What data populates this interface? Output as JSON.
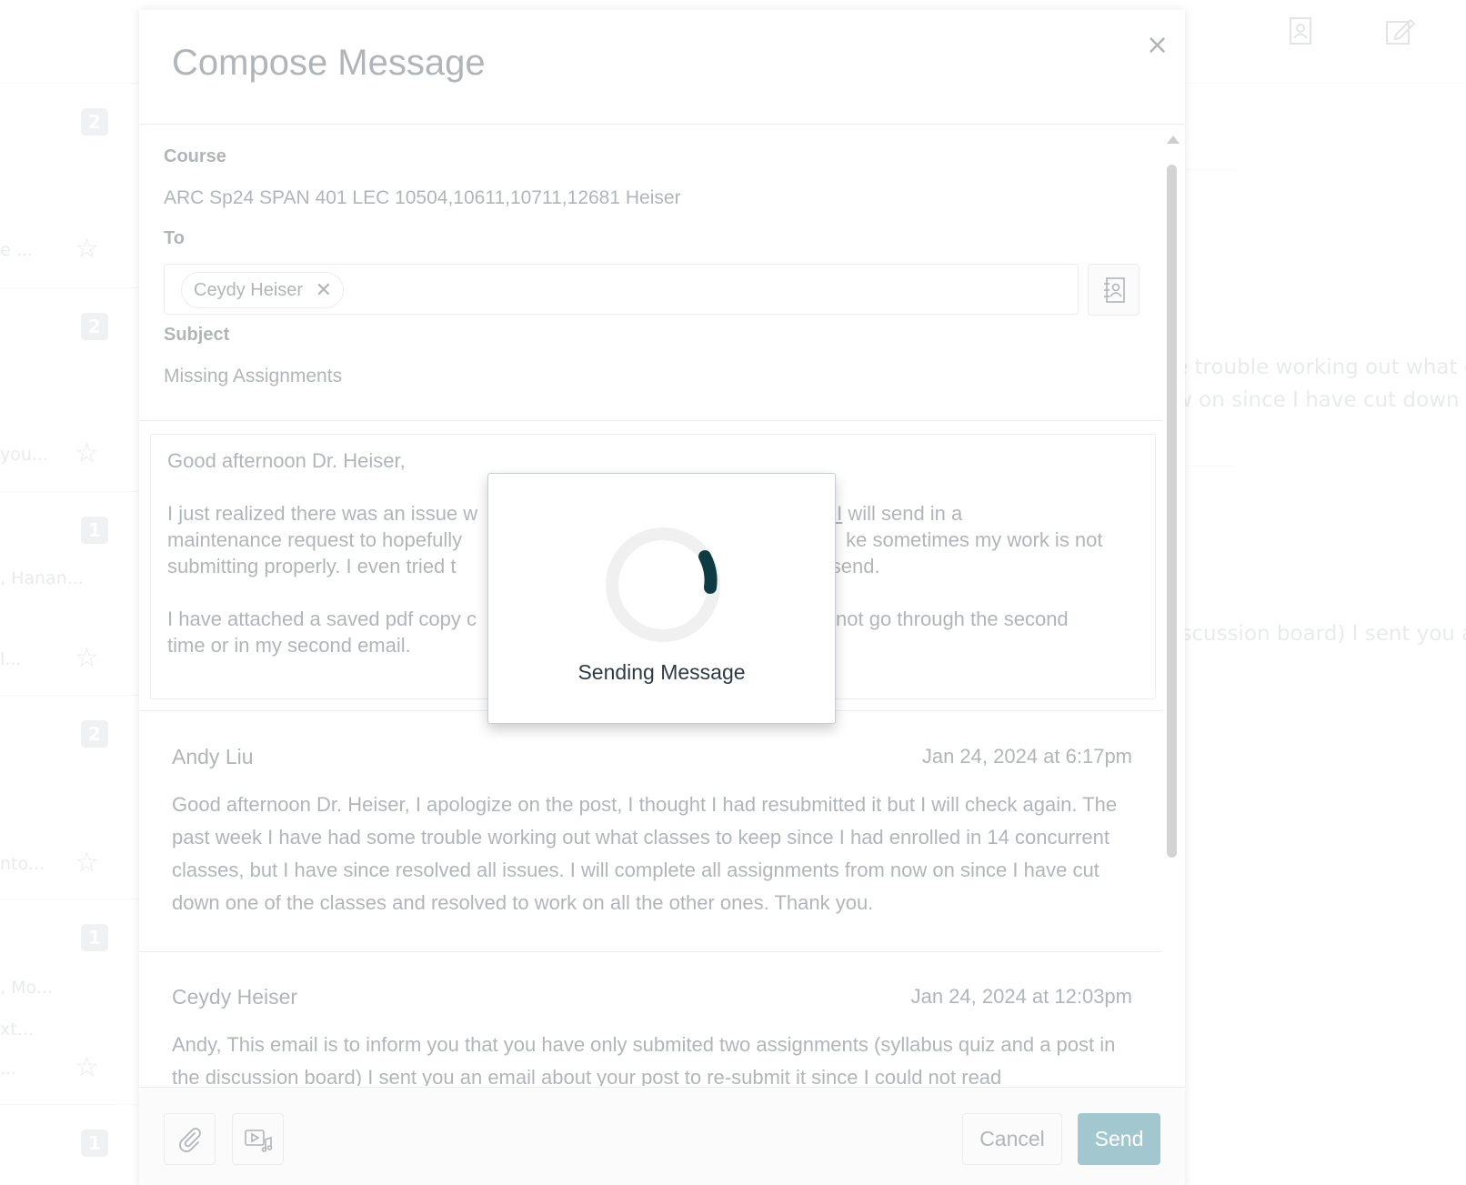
{
  "background": {
    "counts": [
      "2",
      "2",
      "1",
      "2",
      "1",
      "1"
    ],
    "snippets": [
      "e ...",
      "you...",
      ", Hanan...",
      "l...",
      "nto...",
      ", Mo...",
      "xt...",
      "..."
    ],
    "right_preview_1": [
      "e trouble working out what cl",
      "w on since I have cut down or"
    ],
    "right_preview_2": "iscussion board) I sent you an"
  },
  "dialog": {
    "title": "Compose Message",
    "close_symbol": "×",
    "course_label": "Course",
    "course_value": "ARC Sp24 SPAN 401 LEC 10504,10611,10711,12681 Heiser",
    "to_label": "To",
    "recipient": "Ceydy Heiser",
    "recipient_remove_symbol": "✕",
    "subject_label": "Subject",
    "subject_value": "Missing Assignments",
    "body": {
      "greeting": "Good afternoon Dr. Heiser,",
      "p1_start": "I just realized there was an issue w",
      "p1_link": "ent-I",
      "p1_end": " will send in a",
      "p1_line2_start": "maintenance request to hopefully",
      "p1_line2_end": "ke sometimes my work is not",
      "p1_line3_start": "submitting properly. I even tried t",
      "p1_line3_end": "t send.",
      "p2_line1_start": "I have attached a saved pdf copy c",
      "p2_line1_end": "l not go through the second",
      "p2_line2": "time or in my second email."
    },
    "messages": [
      {
        "author": "Andy Liu",
        "date": "Jan 24, 2024 at 6:17pm",
        "body": "Good afternoon Dr. Heiser, I apologize on the post, I thought I had resubmitted it but I will check again. The past week I have had some trouble working out what classes to keep since I had enrolled in 14 concurrent classes, but I have since resolved all issues. I will complete all assignments from now on since I have cut down one of the classes and resolved to work on all the other ones. Thank you."
      },
      {
        "author": "Ceydy Heiser",
        "date": "Jan 24, 2024 at 12:03pm",
        "body": "Andy, This email is to inform you that you have only submited two assignments (syllabus quiz and a post in the discussion board) I sent you an email about your post to re-submit it since I could not read"
      }
    ],
    "cancel_label": "Cancel",
    "send_label": "Send"
  },
  "sending_modal": {
    "text": "Sending Message"
  },
  "colors": {
    "send_button": "#0b6b80",
    "spinner_arc": "#0e3a44",
    "spinner_track": "#f0f0f0",
    "text": "#2d3b45",
    "border": "#c7cdd1"
  },
  "icons": {
    "close": "close-icon",
    "remove_recipient": "x-icon",
    "address_book": "address-book-icon",
    "attachment": "paperclip-icon",
    "media": "media-icon",
    "compose": "compose-icon",
    "star": "star-icon"
  }
}
